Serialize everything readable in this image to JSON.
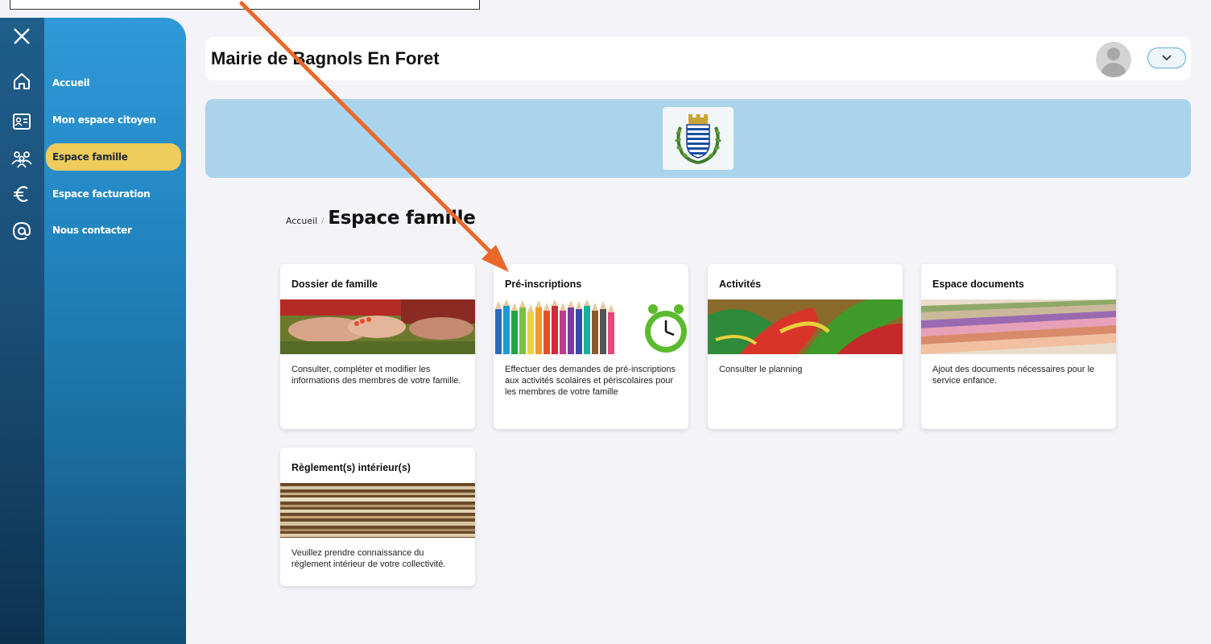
{
  "header": {
    "title": "Mairie de Bagnols En Foret"
  },
  "sidebar": {
    "items": [
      {
        "label": "Accueil",
        "icon": "home-icon"
      },
      {
        "label": "Mon espace citoyen",
        "icon": "id-card-icon"
      },
      {
        "label": "Espace famille",
        "icon": "family-icon",
        "active": true
      },
      {
        "label": "Espace facturation",
        "icon": "euro-icon"
      },
      {
        "label": "Nous contacter",
        "icon": "at-icon"
      }
    ]
  },
  "breadcrumb": {
    "home": "Accueil",
    "separator": "/",
    "current": "Espace famille"
  },
  "cards": [
    {
      "title": "Dossier de famille",
      "description": "Consulter, compléter et modifier les informations des membres de votre famille."
    },
    {
      "title": "Pré-inscriptions",
      "description": "Effectuer des demandes de pré-inscriptions aux activités scolaires et périscolaires pour les membres de votre famille"
    },
    {
      "title": "Activités",
      "description": "Consulter le planning"
    },
    {
      "title": "Espace documents",
      "description": "Ajout des documents nécessaires pour le service enfance."
    },
    {
      "title": "Règlement(s) intérieur(s)",
      "description": "Veuillez prendre connaissance du règlement intérieur de votre collectivité."
    }
  ],
  "colors": {
    "active_nav": "#eecb5a",
    "banner": "#a9d4ec",
    "annotation_arrow": "#e8692a"
  }
}
